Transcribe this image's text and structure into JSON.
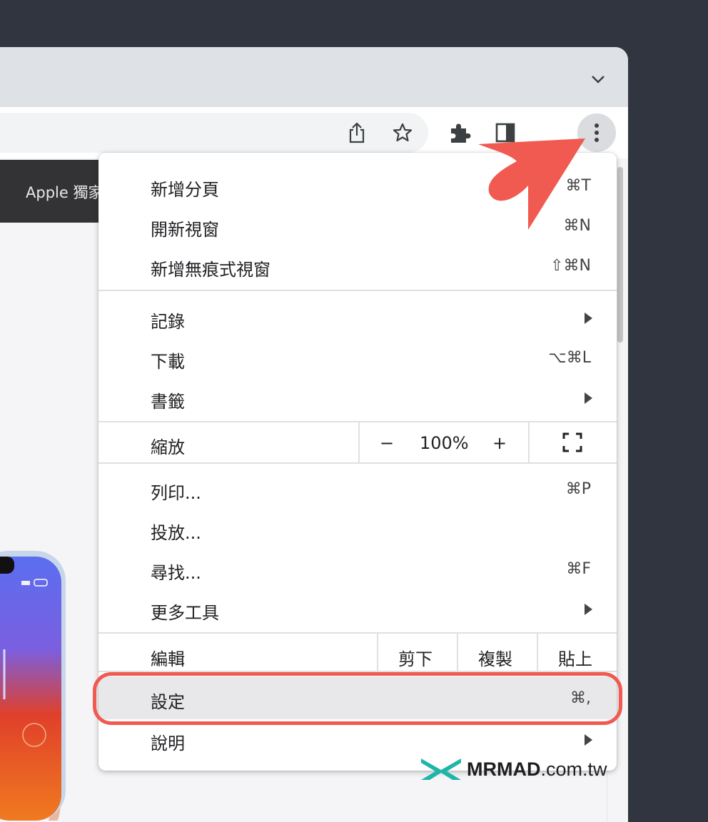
{
  "site": {
    "nav_text": "Apple 獨家"
  },
  "menu": {
    "items": [
      {
        "label": "新增分頁",
        "shortcut": "⌘T"
      },
      {
        "label": "開新視窗",
        "shortcut": "⌘N"
      },
      {
        "label": "新增無痕式視窗",
        "shortcut": "⇧⌘N"
      },
      {
        "label": "記錄",
        "shortcut": ""
      },
      {
        "label": "下載",
        "shortcut": "⌥⌘L"
      },
      {
        "label": "書籤",
        "shortcut": ""
      },
      {
        "label": "列印...",
        "shortcut": "⌘P"
      },
      {
        "label": "投放...",
        "shortcut": ""
      },
      {
        "label": "尋找...",
        "shortcut": "⌘F"
      },
      {
        "label": "更多工具",
        "shortcut": ""
      },
      {
        "label": "設定",
        "shortcut": "⌘,"
      },
      {
        "label": "說明",
        "shortcut": ""
      }
    ],
    "zoom": {
      "label": "縮放",
      "minus": "−",
      "value": "100%",
      "plus": "+"
    },
    "edit": {
      "label": "編輯",
      "cut": "剪下",
      "copy": "複製",
      "paste": "貼上"
    }
  },
  "watermark": {
    "brand": "MRMAD",
    "domain": ".com.tw"
  },
  "colors": {
    "highlight": "#f05a50",
    "menu_bg": "#ffffff",
    "titlebar": "#dee1e6",
    "hover": "#e8e8ea"
  }
}
